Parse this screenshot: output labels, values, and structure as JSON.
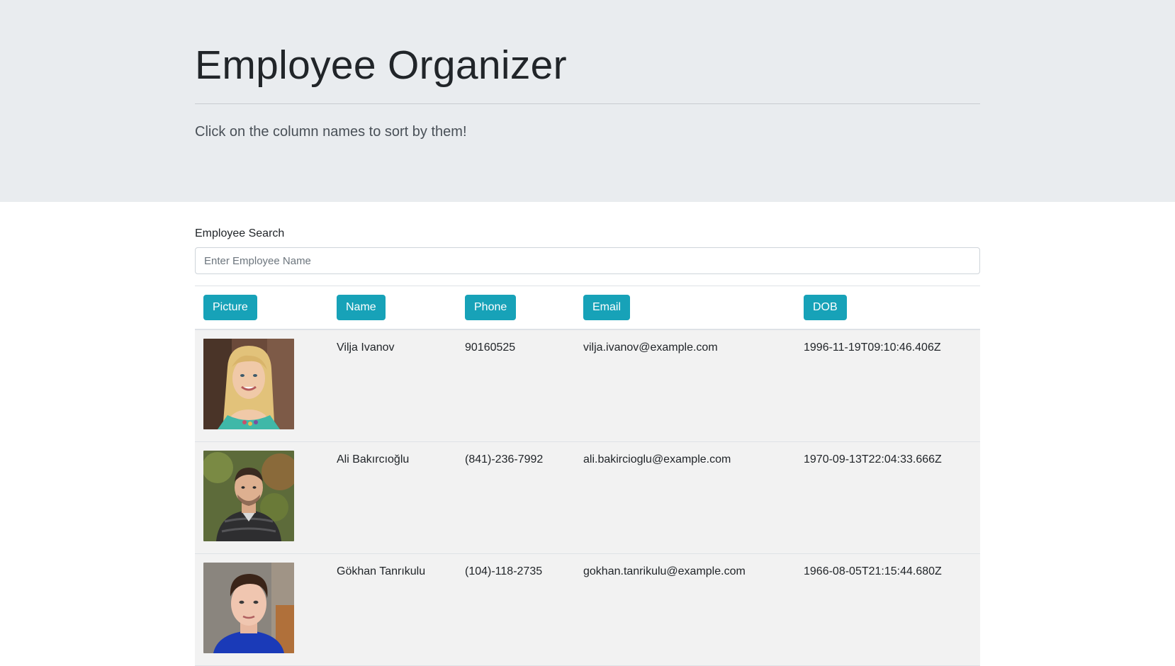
{
  "header": {
    "title": "Employee Organizer",
    "subtitle": "Click on the column names to sort by them!"
  },
  "search": {
    "label": "Employee Search",
    "placeholder": "Enter Employee Name",
    "value": ""
  },
  "table": {
    "columns": [
      "Picture",
      "Name",
      "Phone",
      "Email",
      "DOB"
    ],
    "rows": [
      {
        "picture": "woman-blonde-portrait",
        "name": "Vilja Ivanov",
        "phone": "90160525",
        "email": "vilja.ivanov@example.com",
        "dob": "1996-11-19T09:10:46.406Z"
      },
      {
        "picture": "man-jacket-portrait",
        "name": "Ali Bakırcıoğlu",
        "phone": "(841)-236-7992",
        "email": "ali.bakircioglu@example.com",
        "dob": "1970-09-13T22:04:33.666Z"
      },
      {
        "picture": "man-blue-shirt-portrait",
        "name": "Gökhan Tanrıkulu",
        "phone": "(104)-118-2735",
        "email": "gokhan.tanrikulu@example.com",
        "dob": "1966-08-05T21:15:44.680Z"
      }
    ]
  },
  "colors": {
    "jumbotron_bg": "#e9ecef",
    "button_bg": "#17a2b8",
    "row_bg": "#f2f2f2"
  }
}
